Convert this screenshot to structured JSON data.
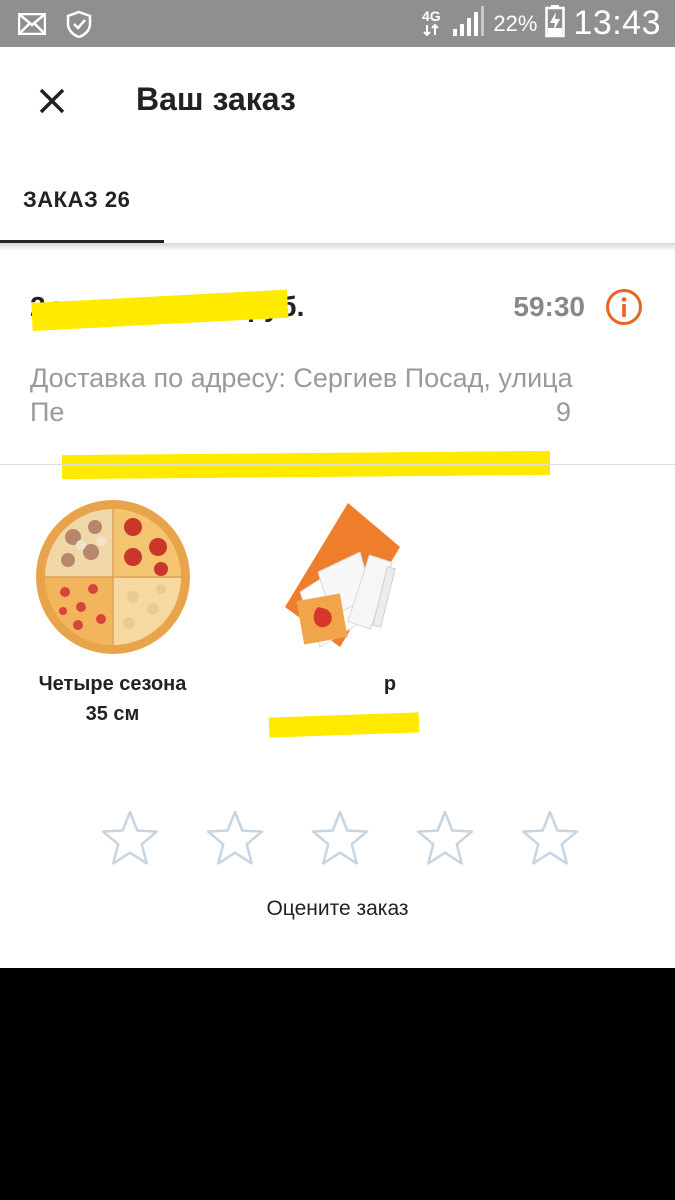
{
  "status_bar": {
    "network_type": "4G",
    "battery_percent": "22%",
    "time": "13:43",
    "left_icons": [
      "mail-icon",
      "shield-check-icon"
    ],
    "right_icons": [
      "data-arrows-icon",
      "signal-icon",
      "battery-charging-icon"
    ]
  },
  "toolbar": {
    "title": "Ваш заказ",
    "close_icon": "close-icon"
  },
  "tabs": [
    {
      "label": "ЗАКАЗ 26",
      "active": true
    }
  ],
  "order": {
    "summary": "2 т",
    "summary_end": "руб.",
    "timer": "59:30",
    "info_icon": "info-icon",
    "address_line1": "Доставка по адресу: Сергиев Посад, улица",
    "address_line2_start": "Пе",
    "address_line2_end": "9"
  },
  "products": [
    {
      "name": "Четыре сезона",
      "size": "35 см",
      "image": "pizza-image"
    },
    {
      "name": "р",
      "size": "",
      "image": "napkins-kit-image"
    }
  ],
  "rating": {
    "stars_total": 5,
    "stars_selected": 0,
    "prompt": "Оцените заказ"
  },
  "colors": {
    "accent": "#e8641f",
    "status_bar": "#8f8f8f",
    "text": "#222222",
    "muted_text": "#9a9a9a",
    "redaction": "#ffea00",
    "star_outline": "#c7d4e1"
  }
}
